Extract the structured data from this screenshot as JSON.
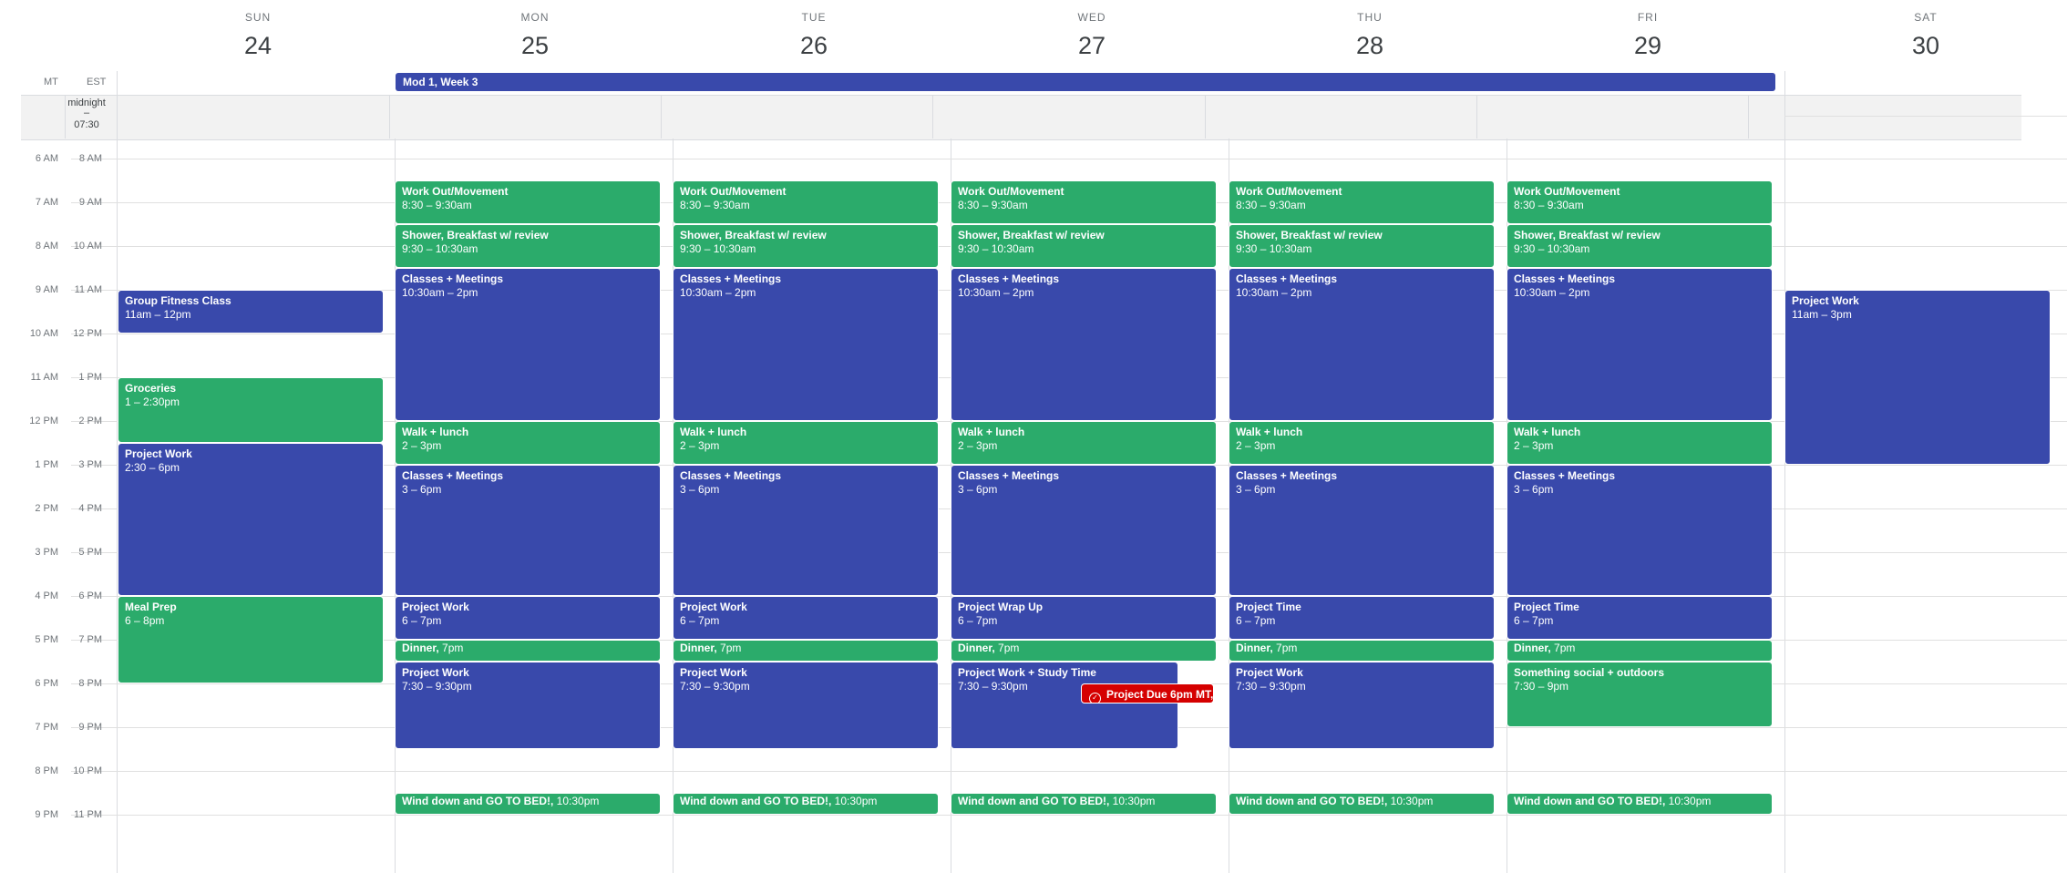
{
  "timezones": [
    "MT",
    "EST"
  ],
  "days": [
    {
      "dow": "SUN",
      "num": "24"
    },
    {
      "dow": "MON",
      "num": "25"
    },
    {
      "dow": "TUE",
      "num": "26"
    },
    {
      "dow": "WED",
      "num": "27"
    },
    {
      "dow": "THU",
      "num": "28"
    },
    {
      "dow": "FRI",
      "num": "29"
    },
    {
      "dow": "SAT",
      "num": "30"
    }
  ],
  "allday": {
    "banner": "Mod 1, Week 3",
    "collapsed_range": [
      "midnight",
      "–",
      "07:30"
    ]
  },
  "time_rows": [
    {
      "mt": "6 AM",
      "est": "8 AM"
    },
    {
      "mt": "7 AM",
      "est": "9 AM"
    },
    {
      "mt": "8 AM",
      "est": "10 AM"
    },
    {
      "mt": "9 AM",
      "est": "11 AM"
    },
    {
      "mt": "10 AM",
      "est": "12 PM"
    },
    {
      "mt": "11 AM",
      "est": "1 PM"
    },
    {
      "mt": "12 PM",
      "est": "2 PM"
    },
    {
      "mt": "1 PM",
      "est": "3 PM"
    },
    {
      "mt": "2 PM",
      "est": "4 PM"
    },
    {
      "mt": "3 PM",
      "est": "5 PM"
    },
    {
      "mt": "4 PM",
      "est": "6 PM"
    },
    {
      "mt": "5 PM",
      "est": "7 PM"
    },
    {
      "mt": "6 PM",
      "est": "8 PM"
    },
    {
      "mt": "7 PM",
      "est": "9 PM"
    },
    {
      "mt": "8 PM",
      "est": "10 PM"
    },
    {
      "mt": "9 PM",
      "est": "11 PM"
    }
  ],
  "events": {
    "sun": [
      {
        "title": "Group Fitness Class",
        "time": "11am – 12pm"
      },
      {
        "title": "Groceries",
        "time": "1 – 2:30pm"
      },
      {
        "title": "Project Work",
        "time": "2:30 – 6pm"
      },
      {
        "title": "Meal Prep",
        "time": "6 – 8pm"
      }
    ],
    "mon": [
      {
        "title": "Work Out/Movement",
        "time": "8:30 – 9:30am"
      },
      {
        "title": "Shower, Breakfast w/ review",
        "time": "9:30 – 10:30am"
      },
      {
        "title": "Classes + Meetings",
        "time": "10:30am – 2pm"
      },
      {
        "title": "Walk + lunch",
        "time": "2 – 3pm"
      },
      {
        "title": "Classes + Meetings",
        "time": "3 – 6pm"
      },
      {
        "title": "Project Work",
        "time": "6 – 7pm"
      },
      {
        "title": "Dinner,",
        "time": "7pm"
      },
      {
        "title": "Project Work",
        "time": "7:30 – 9:30pm"
      },
      {
        "title": "Wind down and GO TO BED!,",
        "time": "10:30pm"
      }
    ],
    "tue": [
      {
        "title": "Work Out/Movement",
        "time": "8:30 – 9:30am"
      },
      {
        "title": "Shower, Breakfast w/ review",
        "time": "9:30 – 10:30am"
      },
      {
        "title": "Classes + Meetings",
        "time": "10:30am – 2pm"
      },
      {
        "title": "Walk + lunch",
        "time": "2 – 3pm"
      },
      {
        "title": "Classes + Meetings",
        "time": "3 – 6pm"
      },
      {
        "title": "Project Work",
        "time": "6 – 7pm"
      },
      {
        "title": "Dinner,",
        "time": "7pm"
      },
      {
        "title": "Project Work",
        "time": "7:30 – 9:30pm"
      },
      {
        "title": "Wind down and GO TO BED!,",
        "time": "10:30pm"
      }
    ],
    "wed": [
      {
        "title": "Work Out/Movement",
        "time": "8:30 – 9:30am"
      },
      {
        "title": "Shower, Breakfast w/ review",
        "time": "9:30 – 10:30am"
      },
      {
        "title": "Classes + Meetings",
        "time": "10:30am – 2pm"
      },
      {
        "title": "Walk + lunch",
        "time": "2 – 3pm"
      },
      {
        "title": "Classes + Meetings",
        "time": "3 – 6pm"
      },
      {
        "title": "Project Wrap Up",
        "time": "6 – 7pm"
      },
      {
        "title": "Dinner,",
        "time": "7pm"
      },
      {
        "title": "Project Work + Study Time",
        "time": "7:30 – 9:30pm"
      },
      {
        "title": "Wind down and GO TO BED!,",
        "time": "10:30pm"
      }
    ],
    "wed_task": "Project Due 6pm MT,",
    "thu": [
      {
        "title": "Work Out/Movement",
        "time": "8:30 – 9:30am"
      },
      {
        "title": "Shower, Breakfast w/ review",
        "time": "9:30 – 10:30am"
      },
      {
        "title": "Classes + Meetings",
        "time": "10:30am – 2pm"
      },
      {
        "title": "Walk + lunch",
        "time": "2 – 3pm"
      },
      {
        "title": "Classes + Meetings",
        "time": "3 – 6pm"
      },
      {
        "title": "Project Time",
        "time": "6 – 7pm"
      },
      {
        "title": "Dinner,",
        "time": "7pm"
      },
      {
        "title": "Project Work",
        "time": "7:30 – 9:30pm"
      },
      {
        "title": "Wind down and GO TO BED!,",
        "time": "10:30pm"
      }
    ],
    "fri": [
      {
        "title": "Work Out/Movement",
        "time": "8:30 – 9:30am"
      },
      {
        "title": "Shower, Breakfast w/ review",
        "time": "9:30 – 10:30am"
      },
      {
        "title": "Classes + Meetings",
        "time": "10:30am – 2pm"
      },
      {
        "title": "Walk + lunch",
        "time": "2 – 3pm"
      },
      {
        "title": "Classes + Meetings",
        "time": "3 – 6pm"
      },
      {
        "title": "Project Time",
        "time": "6 – 7pm"
      },
      {
        "title": "Dinner,",
        "time": "7pm"
      },
      {
        "title": "Something social + outdoors",
        "time": "7:30 – 9pm"
      },
      {
        "title": "Wind down and GO TO BED!,",
        "time": "10:30pm"
      }
    ],
    "sat": [
      {
        "title": "Project Work",
        "time": "11am – 3pm"
      }
    ]
  },
  "colors": {
    "green": "#2bab6b",
    "blue": "#3949ab",
    "task": "#d50000"
  }
}
